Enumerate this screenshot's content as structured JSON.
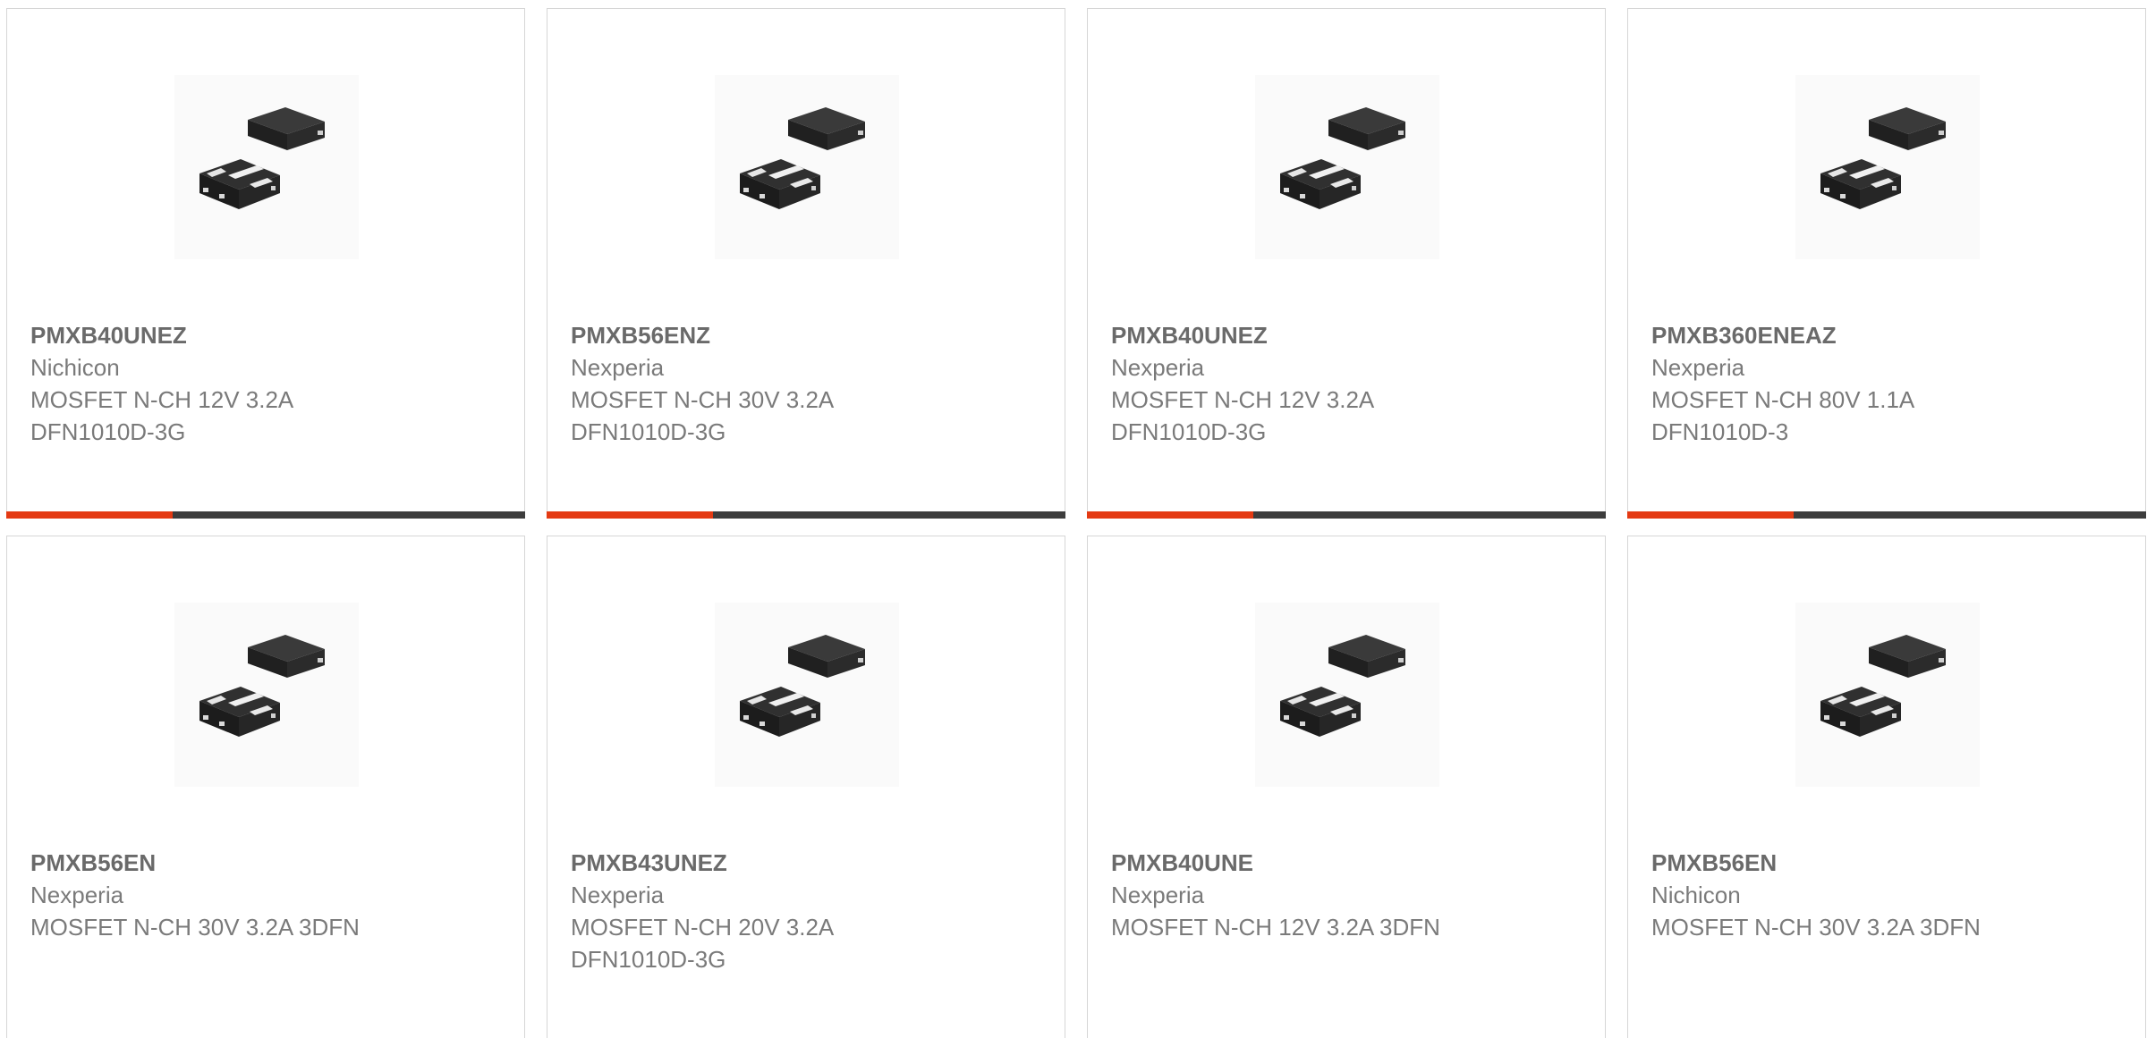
{
  "accent_color": "#e43a13",
  "bar_color": "#3d3d3d",
  "products": [
    {
      "part_number": "PMXB40UNEZ",
      "manufacturer": "Nichicon",
      "description_lines": [
        "MOSFET N-CH 12V 3.2A",
        "DFN1010D-3G"
      ],
      "image_icon": "dfn-package-chip-icon",
      "progress_fraction": 0.32
    },
    {
      "part_number": "PMXB56ENZ",
      "manufacturer": "Nexperia",
      "description_lines": [
        "MOSFET N-CH 30V 3.2A",
        "DFN1010D-3G"
      ],
      "image_icon": "dfn-package-chip-icon",
      "progress_fraction": 0.32
    },
    {
      "part_number": "PMXB40UNEZ",
      "manufacturer": "Nexperia",
      "description_lines": [
        "MOSFET N-CH 12V 3.2A",
        "DFN1010D-3G"
      ],
      "image_icon": "dfn-package-chip-icon",
      "progress_fraction": 0.32
    },
    {
      "part_number": "PMXB360ENEAZ",
      "manufacturer": "Nexperia",
      "description_lines": [
        "MOSFET N-CH 80V 1.1A",
        "DFN1010D-3"
      ],
      "image_icon": "dfn-package-chip-icon",
      "progress_fraction": 0.32
    },
    {
      "part_number": "PMXB56EN",
      "manufacturer": "Nexperia",
      "description_lines": [
        "MOSFET N-CH 30V 3.2A 3DFN"
      ],
      "image_icon": "dfn-package-chip-icon"
    },
    {
      "part_number": "PMXB43UNEZ",
      "manufacturer": "Nexperia",
      "description_lines": [
        "MOSFET N-CH 20V 3.2A",
        "DFN1010D-3G"
      ],
      "image_icon": "dfn-package-chip-icon"
    },
    {
      "part_number": "PMXB40UNE",
      "manufacturer": "Nexperia",
      "description_lines": [
        "MOSFET N-CH 12V 3.2A 3DFN"
      ],
      "image_icon": "dfn-package-chip-icon"
    },
    {
      "part_number": "PMXB56EN",
      "manufacturer": "Nichicon",
      "description_lines": [
        "MOSFET N-CH 30V 3.2A 3DFN"
      ],
      "image_icon": "dfn-package-chip-icon"
    }
  ]
}
